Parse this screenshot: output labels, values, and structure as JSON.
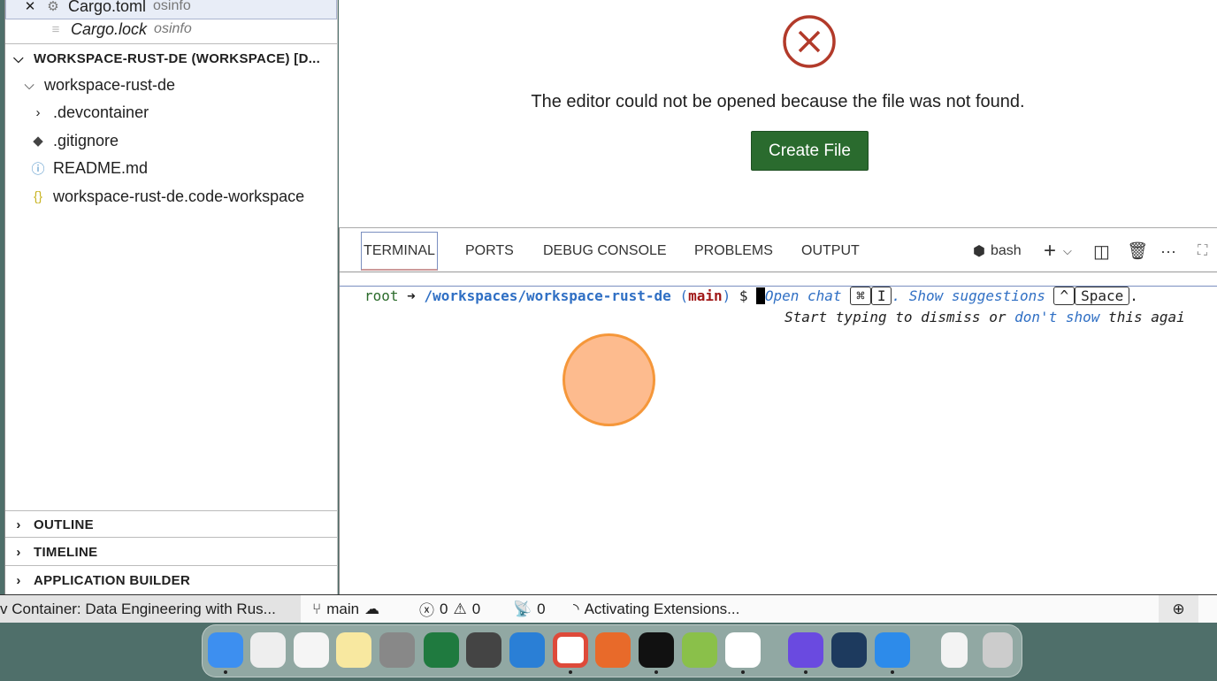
{
  "sidebar": {
    "open_editors": [
      {
        "name": "Cargo.toml",
        "desc": "osinfo"
      },
      {
        "name": "Cargo.lock",
        "desc": "osinfo"
      }
    ],
    "workspace_header": "WORKSPACE-RUST-DE (WORKSPACE) [D...",
    "folder": "workspace-rust-de",
    "items": [
      ".devcontainer",
      ".gitignore",
      "README.md",
      "workspace-rust-de.code-workspace"
    ],
    "sections": [
      "OUTLINE",
      "TIMELINE",
      "APPLICATION BUILDER"
    ]
  },
  "editor": {
    "message": "The editor could not be opened because the file was not found.",
    "create_button": "Create File",
    "error_color": "#b23a2a",
    "button_color": "#2a6b2e"
  },
  "panel": {
    "tabs": [
      "TERMINAL",
      "PORTS",
      "DEBUG CONSOLE",
      "PROBLEMS",
      "OUTPUT"
    ],
    "shell": "bash",
    "terminal": {
      "user": "root",
      "arrow": "➜",
      "path": "/workspaces/workspace-rust-de",
      "branch_open": "(",
      "branch": "main",
      "branch_close": ")",
      "prompt": "$",
      "hint_open_chat": "Open chat",
      "key_cmd": "⌘",
      "key_i": "I",
      "hint_show": ". Show suggestions",
      "key_ctrl": "^",
      "key_space": "Space",
      "hint_end": ".",
      "line2_a": "Start typing to dismiss or ",
      "line2_link": "don't show",
      "line2_b": " this agai"
    }
  },
  "status": {
    "remote": "v Container: Data Engineering with Rus...",
    "branch": "main",
    "errors": "0",
    "warnings": "0",
    "ports": "0",
    "activity": "Activating Extensions..."
  },
  "dock": {
    "apps": [
      "Finder",
      "Launchpad",
      "Reminders",
      "Notes",
      "System Settings",
      "Excel",
      "Sublime Text",
      "Outlook",
      "Chrome",
      "Firefox",
      "Terminal",
      "Maps",
      "VS Code",
      "App",
      "Rider",
      "Docker",
      "Downloads",
      "Trash"
    ]
  }
}
